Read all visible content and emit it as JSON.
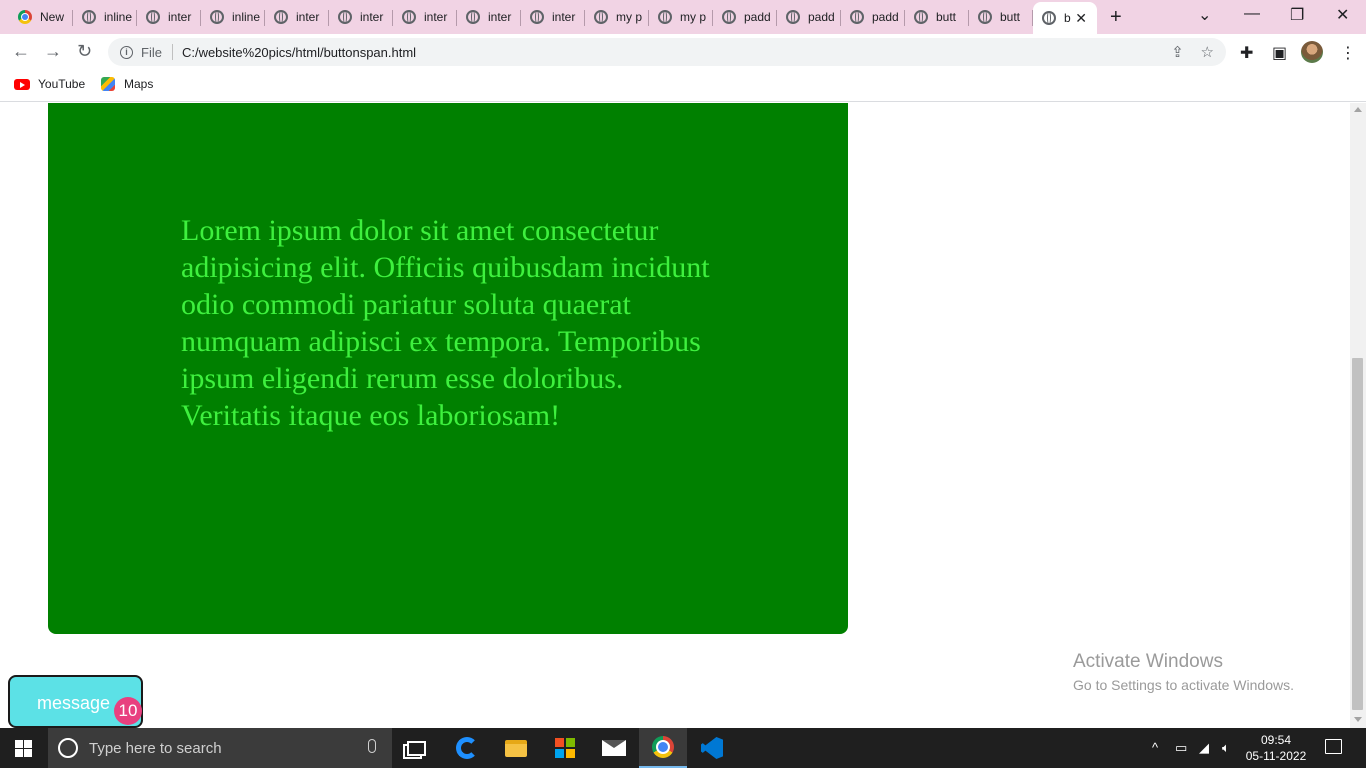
{
  "browser": {
    "tabs": [
      {
        "title": "New",
        "icon": "chrome-icon"
      },
      {
        "title": "inline",
        "icon": "globe-icon"
      },
      {
        "title": "inter",
        "icon": "globe-icon"
      },
      {
        "title": "inline",
        "icon": "globe-icon"
      },
      {
        "title": "inter",
        "icon": "globe-icon"
      },
      {
        "title": "inter",
        "icon": "globe-icon"
      },
      {
        "title": "inter",
        "icon": "globe-icon"
      },
      {
        "title": "inter",
        "icon": "globe-icon"
      },
      {
        "title": "inter",
        "icon": "globe-icon"
      },
      {
        "title": "my p",
        "icon": "globe-icon"
      },
      {
        "title": "my p",
        "icon": "globe-icon"
      },
      {
        "title": "padd",
        "icon": "globe-icon"
      },
      {
        "title": "padd",
        "icon": "globe-icon"
      },
      {
        "title": "padd",
        "icon": "globe-icon"
      },
      {
        "title": "butt",
        "icon": "globe-icon"
      },
      {
        "title": "butt",
        "icon": "globe-icon"
      },
      {
        "title": "b",
        "icon": "globe-icon",
        "active": true
      }
    ],
    "address": {
      "scheme_label": "File",
      "url": "C:/website%20pics/html/buttonspan.html"
    },
    "bookmarks": [
      {
        "label": "YouTube",
        "icon": "youtube-icon"
      },
      {
        "label": "Maps",
        "icon": "maps-icon"
      }
    ]
  },
  "page": {
    "paragraph": "Lorem ipsum dolor sit amet consectetur adipisicing elit. Officiis quibusdam incidunt odio commodi pariatur soluta quaerat numquam adipisci ex tempora. Temporibus ipsum eligendi rerum esse doloribus. Veritatis itaque eos laboriosam!",
    "box_color": "#008000",
    "text_color": "#3ef03e",
    "message_button": {
      "label": "message",
      "badge": "10",
      "bg_color": "#5ce1e6",
      "badge_color": "#e8407f"
    }
  },
  "watermark": {
    "title": "Activate Windows",
    "subtitle": "Go to Settings to activate Windows."
  },
  "taskbar": {
    "search_placeholder": "Type here to search",
    "time": "09:54",
    "date": "05-11-2022"
  }
}
